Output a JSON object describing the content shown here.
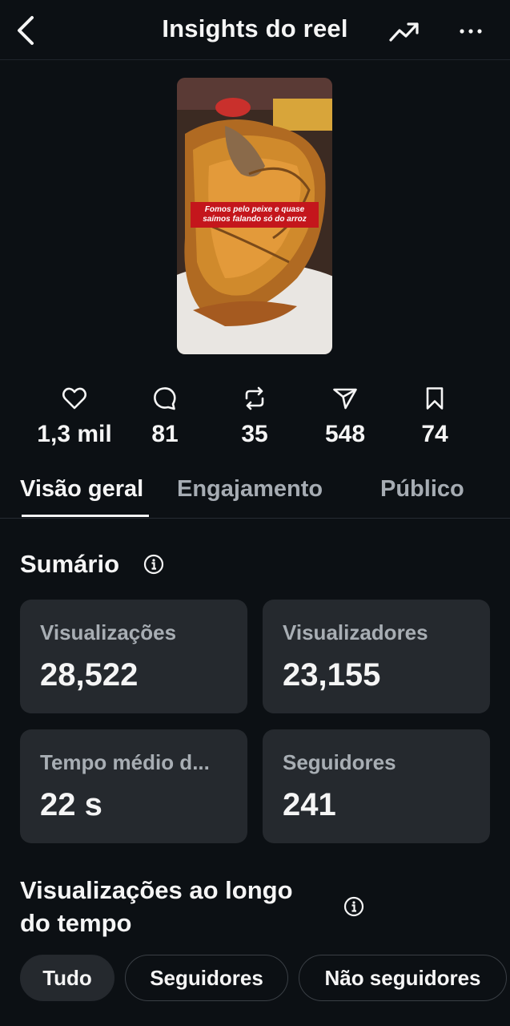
{
  "header": {
    "title": "Insights do reel",
    "back_icon": "chevron-left-icon",
    "trend_icon": "trending-up-icon",
    "more_icon": "more-horizontal-icon"
  },
  "thumbnail": {
    "caption": "Fomos pelo peixe e quase saímos falando só do arroz"
  },
  "stats": [
    {
      "icon": "heart-icon",
      "value": "1,3 mil"
    },
    {
      "icon": "comment-icon",
      "value": "81"
    },
    {
      "icon": "repost-icon",
      "value": "35"
    },
    {
      "icon": "share-icon",
      "value": "548"
    },
    {
      "icon": "bookmark-icon",
      "value": "74"
    }
  ],
  "tabs": [
    {
      "label": "Visão geral",
      "active": true
    },
    {
      "label": "Engajamento",
      "active": false
    },
    {
      "label": "Público",
      "active": false
    }
  ],
  "summary": {
    "title": "Sumário",
    "cards": [
      {
        "label": "Visualizações",
        "value": "28,522"
      },
      {
        "label": "Visualizadores",
        "value": "23,155"
      },
      {
        "label": "Tempo médio d...",
        "value": "22 s"
      },
      {
        "label": "Seguidores",
        "value": "241"
      }
    ]
  },
  "views_over_time": {
    "title_line1": "Visualizações ao longo",
    "title_line2": "do tempo",
    "filters": [
      {
        "label": "Tudo",
        "active": true
      },
      {
        "label": "Seguidores",
        "active": false
      },
      {
        "label": "Não seguidores",
        "active": false
      }
    ]
  },
  "colors": {
    "background": "#0c1014",
    "card": "#25292e",
    "muted_text": "#a8aeb4",
    "caption_red": "#c4161c"
  }
}
